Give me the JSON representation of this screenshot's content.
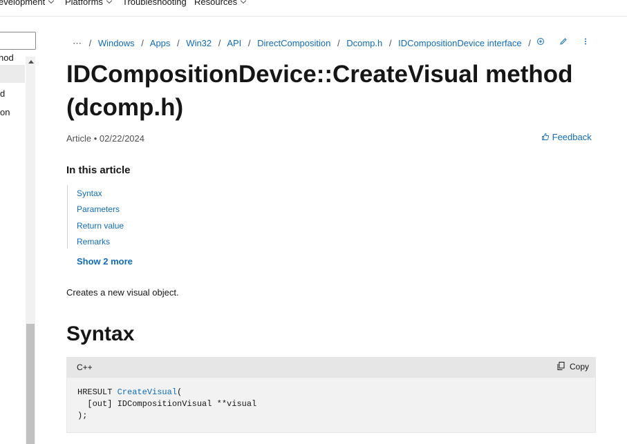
{
  "topnav": {
    "items": [
      "evelopment",
      "Platforms",
      "Troubleshooting",
      "Resources"
    ]
  },
  "sidebar": {
    "filter_value": "",
    "rows": [
      "hod",
      "d",
      "on"
    ]
  },
  "breadcrumb": {
    "more": "⋯",
    "items": [
      "Windows",
      "Apps",
      "Win32",
      "API",
      "DirectComposition",
      "Dcomp.h",
      "IDCompositionDevice interface"
    ]
  },
  "page": {
    "title": "IDCompositionDevice::CreateVisual method (dcomp.h)",
    "article_label": "Article",
    "date": "02/22/2024",
    "feedback_label": "Feedback",
    "in_this_article": "In this article",
    "toc": [
      "Syntax",
      "Parameters",
      "Return value",
      "Remarks"
    ],
    "show_more": "Show 2 more",
    "description": "Creates a new visual object.",
    "syntax_heading": "Syntax"
  },
  "code": {
    "language": "C++",
    "copy_label": "Copy",
    "line1_prefix": "HRESULT ",
    "line1_fn": "CreateVisual",
    "line1_suffix": "(",
    "line2": "  [out] IDCompositionVisual **visual",
    "line3": ");"
  },
  "icons": {
    "focus": "focus-mode-icon",
    "edit": "edit-pencil-icon",
    "more": "more-options-icon",
    "feedback": "thumbs-up-icon",
    "copy": "copy-icon"
  }
}
